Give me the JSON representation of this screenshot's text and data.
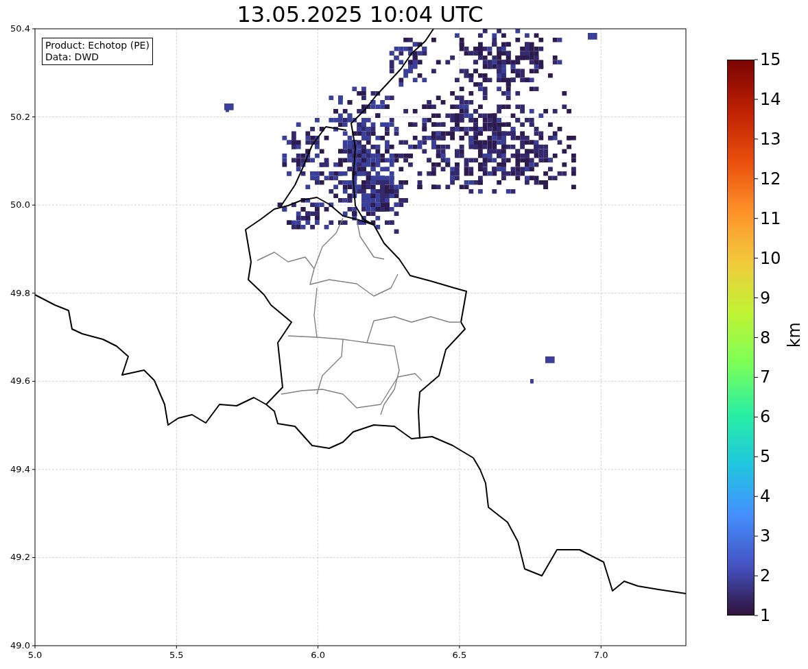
{
  "title": "13.05.2025 10:04 UTC",
  "legend": [
    "Product: Echotop (PE)",
    "Data: DWD"
  ],
  "x_ticks": [
    "5.0",
    "5.5",
    "6.0",
    "6.5",
    "7.0"
  ],
  "y_ticks": [
    "50.4",
    "50.2",
    "50.0",
    "49.8",
    "49.6",
    "49.4",
    "49.2",
    "49.0"
  ],
  "colorbar": {
    "label": "km",
    "ticks": [
      "15",
      "14",
      "13",
      "12",
      "11",
      "10",
      "9",
      "8",
      "7",
      "6",
      "5",
      "4",
      "3",
      "2",
      "1"
    ]
  }
}
